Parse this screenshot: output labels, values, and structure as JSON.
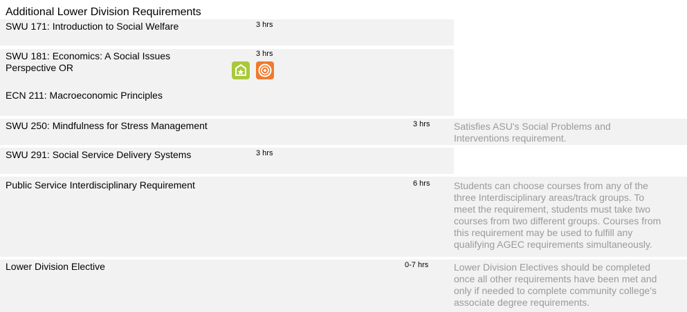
{
  "section_title": "Additional Lower Division Requirements",
  "courses": [
    {
      "name": "SWU 171: Introduction to Social Welfare",
      "hours": "3 hrs"
    },
    {
      "name_line1": "SWU 181: Economics: A Social Issues",
      "name_line2": "Perspective OR",
      "alt_name": "ECN 211: Macroeconomic Principles",
      "hours": "3 hrs",
      "icons": [
        "general-studies-star-icon",
        "global-awareness-target-icon"
      ]
    },
    {
      "name": "SWU 250: Mindfulness for Stress Management",
      "hours": "3 hrs",
      "note_lines": [
        "Satisfies ASU's Social Problems and",
        "Interventions requirement."
      ]
    },
    {
      "name": "SWU 291: Social Service Delivery Systems",
      "hours": "3 hrs"
    },
    {
      "name": "Public Service Interdisciplinary Requirement",
      "hours": "6 hrs",
      "note_lines": [
        "Students can choose courses from any of the",
        "three Interdisciplinary areas/track groups. To",
        "meet the requirement, students must take two",
        "courses from two different groups. Courses from",
        "this requirement may be used to fulfill any",
        "qualifying AGEC requirements simultaneously."
      ]
    },
    {
      "name": "Lower Division Elective",
      "hours": "0-7 hrs",
      "note_lines": [
        "Lower Division Electives should be completed",
        "once all other requirements have been met and",
        "only if needed to complete community college's",
        "associate degree requirements."
      ]
    }
  ],
  "colors": {
    "row_bg": "#f2f2f2",
    "note_text": "#9a9a9a",
    "badge_green": "#a9c93a",
    "badge_orange": "#f07a2e"
  }
}
